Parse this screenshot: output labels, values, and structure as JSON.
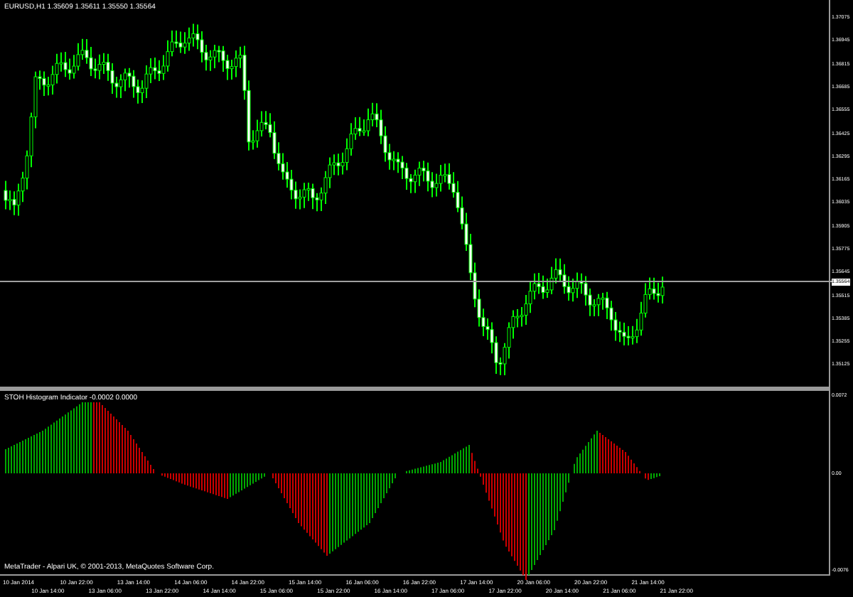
{
  "main_chart": {
    "symbol_info": "EURUSD,H1  1.35609 1.35611 1.35550 1.35564",
    "price_labels": [
      "1.37075",
      "1.36945",
      "1.36815",
      "1.36685",
      "1.36555",
      "1.36425",
      "1.36295",
      "1.36165",
      "1.36035",
      "1.35905",
      "1.35775",
      "1.35645"
    ],
    "current_price": "1.35564",
    "lower_price_labels": [
      "1.35515",
      "1.35385",
      "1.35255",
      "1.35125"
    ]
  },
  "indicator": {
    "title": "STOH Histogram Indicator -0.0002 0.0000",
    "labels": [
      "0.0072",
      "0.00",
      "-0.0076"
    ]
  },
  "copyright": "MetaTrader - Alpari UK, © 2001-2013, MetaQuotes Software Corp.",
  "time_labels": [
    "10 Jan 2014",
    "10 Jan 14:00",
    "10 Jan 22:00",
    "13 Jan 06:00",
    "13 Jan 14:00",
    "13 Jan 22:00",
    "14 Jan 06:00",
    "14 Jan 14:00",
    "14 Jan 22:00",
    "15 Jan 06:00",
    "15 Jan 14:00",
    "15 Jan 22:00",
    "16 Jan 06:00",
    "16 Jan 14:00",
    "16 Jan 22:00",
    "17 Jan 06:00",
    "17 Jan 14:00",
    "17 Jan 22:00",
    "20 Jan 06:00",
    "20 Jan 14:00",
    "20 Jan 22:00",
    "21 Jan 06:00",
    "21 Jan 14:00",
    "21 Jan 22:00"
  ]
}
